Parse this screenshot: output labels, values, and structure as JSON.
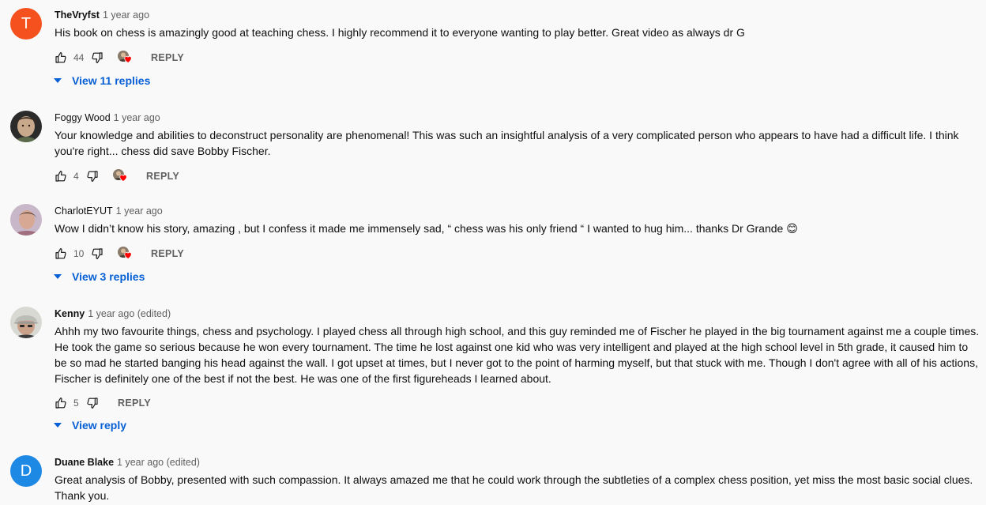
{
  "comments": [
    {
      "author": "TheVryfst",
      "time": "1 year ago",
      "avatar_letter": "T",
      "avatar_color": "#f4511e",
      "text": "His book on chess is amazingly good at teaching chess. I highly recommend it to everyone wanting to play better. Great video as always dr G",
      "likes": "44",
      "hearted": true,
      "reply_label": "REPLY",
      "view_replies": "View 11 replies"
    },
    {
      "author": "Foggy Wood",
      "time": "1 year ago",
      "avatar_icon": "person-photo-avatar",
      "text": "Your knowledge and abilities to deconstruct personality are phenomenal! This was such an insightful analysis of a very complicated person who appears to have had a difficult life. I think you're right... chess did save Bobby Fischer.",
      "likes": "4",
      "hearted": true,
      "reply_label": "REPLY"
    },
    {
      "author": "CharlotEYUT",
      "time": "1 year ago",
      "avatar_icon": "person-photo-avatar",
      "text": "Wow I didn’t know his story, amazing , but I confess it made me immensely sad, “ chess was his only friend “ I wanted to hug him... thanks Dr Grande 😊",
      "likes": "10",
      "hearted": true,
      "reply_label": "REPLY",
      "view_replies": "View 3 replies"
    },
    {
      "author": "Kenny",
      "time": "1 year ago (edited)",
      "avatar_icon": "person-photo-avatar",
      "text": "Ahhh my two favourite things, chess and psychology. I played chess all through high school, and this guy reminded me of Fischer he played in the big tournament against me a couple times. He took the game so serious because he won every tournament. The time he lost against one kid who was very intelligent and played at the high school level in 5th grade, it caused him to be so mad he started banging his head against the wall. I got upset at times, but I never got to the point of harming myself, but that stuck with me. Though I don't agree with all of his actions, Fischer is definitely one of the best if not the best. He was one of the first figureheads I learned about.",
      "likes": "5",
      "hearted": false,
      "reply_label": "REPLY",
      "view_replies": "View reply"
    },
    {
      "author": "Duane Blake",
      "time": "1 year ago (edited)",
      "avatar_letter": "D",
      "avatar_color": "#1e88e5",
      "text": "Great analysis of Bobby, presented with such compassion. It always amazed me that he could work through the subtleties of a complex chess position, yet miss the most basic social clues. Thank you."
    }
  ],
  "colors": {
    "link_blue": "#065fd4",
    "heart_red": "#ff0000",
    "meta_gray": "#606060"
  },
  "icons": {
    "like": "thumb-up-icon",
    "dislike": "thumb-down-icon",
    "creator_heart": "creator-heart-icon",
    "expand": "caret-down-icon"
  }
}
